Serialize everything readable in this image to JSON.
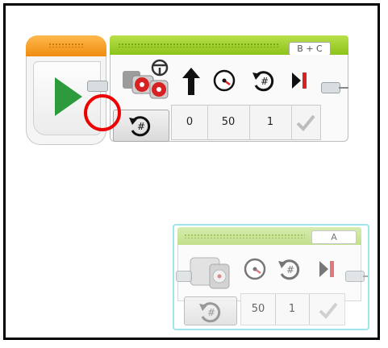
{
  "move_block_1": {
    "ports": "B + C",
    "steering_value": "0",
    "power_value": "50",
    "rotations_value": "1"
  },
  "move_block_2": {
    "port": "A",
    "power_value": "50",
    "rotations_value": "1"
  },
  "colors": {
    "start_orange": "#f08c10",
    "play_green": "#2e9a3e",
    "move_green": "#8cc21a",
    "highlight_red": "#ee0000",
    "selection_cyan": "#9ee6ec"
  },
  "icons": {
    "start": "play-icon",
    "motor": "large-motor-pair-icon",
    "steering": "arrow-up-icon",
    "power": "speedometer-icon",
    "rotations": "rotations-icon",
    "brake": "brake-icon",
    "mode": "rotations-mode-icon",
    "done": "checkmark-icon"
  }
}
